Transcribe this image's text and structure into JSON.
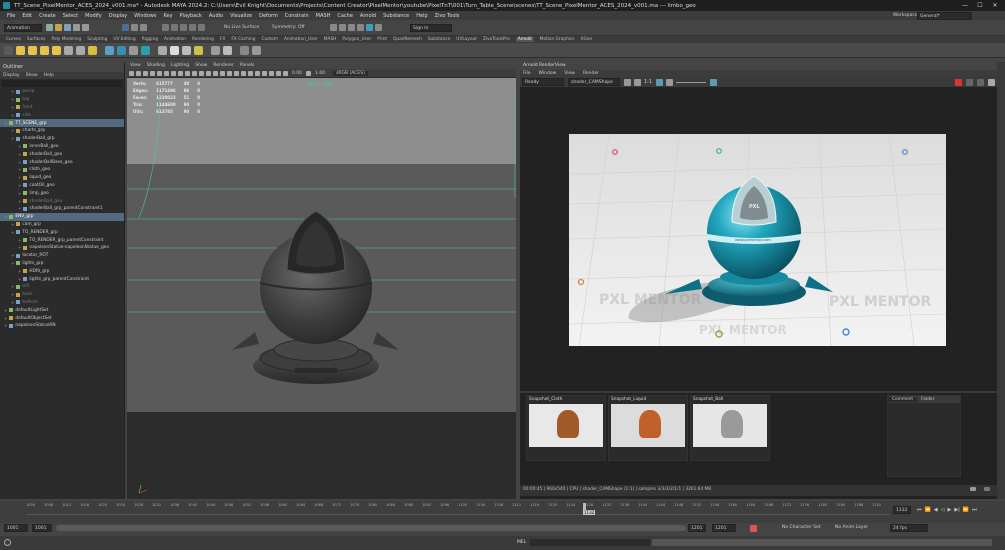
{
  "window": {
    "title": "TT_Scene_PixelMentor_ACES_2024_v001.ma* - Autodesk MAYA 2024.2: C:\\Users\\Evil Knight\\Documents\\Projects\\Content Creator\\PixelMentor\\youtube\\PixelTnT\\001\\Turn_Table_Scene\\scenes\\TT_Scene_PixelMentor_ACES_2024_v001.ma  ---  limbo_geo",
    "minimize": "—",
    "maximize": "☐",
    "close": "✕"
  },
  "menubar": [
    "File",
    "Edit",
    "Create",
    "Select",
    "Modify",
    "Display",
    "Windows",
    "Key",
    "Playback",
    "Audio",
    "Visualize",
    "Deform",
    "Constrain",
    "MASH",
    "Cache",
    "Arnold",
    "Substance",
    "Help",
    "Zivo Tools"
  ],
  "workspace": {
    "label": "Workspace:",
    "value": "General*"
  },
  "statusline": {
    "mode": "Animation",
    "live_surface": "No Live Surface",
    "symmetry": "Symmetry: Off",
    "sign_in": "Sign In"
  },
  "shelf_tabs": [
    "Curves",
    "Surfaces",
    "Poly Modeling",
    "Sculpting",
    "UV Editing",
    "Rigging",
    "Animation",
    "Rendering",
    "FX",
    "FX Caching",
    "Custom",
    "Animation_User",
    "MASH",
    "Polygon_User",
    "Print",
    "QuadRemesh",
    "Substance",
    "UVLayout",
    "ZivoToolsPro",
    "Arnold",
    "Motion Graphics",
    "XGen"
  ],
  "active_shelf": "Arnold",
  "outliner": {
    "title": "Outliner",
    "menu": [
      "Display",
      "Show",
      "Help"
    ],
    "items": [
      {
        "label": "persp",
        "state": "dim",
        "indent": 1
      },
      {
        "label": "top",
        "state": "dim",
        "indent": 1
      },
      {
        "label": "front",
        "state": "dim",
        "indent": 1
      },
      {
        "label": "side",
        "state": "dim",
        "indent": 1
      },
      {
        "label": "TT_SCENE_grp",
        "state": "sel",
        "indent": 0
      },
      {
        "label": "charts_grp",
        "state": "",
        "indent": 1
      },
      {
        "label": "shaderBall_grp",
        "state": "",
        "indent": 1
      },
      {
        "label": "innerBall_geo",
        "state": "",
        "indent": 2
      },
      {
        "label": "shaderBall_geo",
        "state": "",
        "indent": 2
      },
      {
        "label": "shaderBallBase_geo",
        "state": "",
        "indent": 2
      },
      {
        "label": "cloth_geo",
        "state": "",
        "indent": 2
      },
      {
        "label": "liquid_geo",
        "state": "",
        "indent": 2
      },
      {
        "label": "coatOil_geo",
        "state": "",
        "indent": 2
      },
      {
        "label": "limp_geo",
        "state": "",
        "indent": 2
      },
      {
        "label": "shaderBall_geo",
        "state": "dim",
        "indent": 2
      },
      {
        "label": "shaderBall_grp_parentConstraint1",
        "state": "",
        "indent": 2
      },
      {
        "label": "ENV_grp",
        "state": "sel",
        "indent": 0
      },
      {
        "label": "cam_grp",
        "state": "",
        "indent": 1
      },
      {
        "label": "TO_RENDER_grp",
        "state": "",
        "indent": 1
      },
      {
        "label": "TO_RENDER_grp_parentConstraint",
        "state": "",
        "indent": 2
      },
      {
        "label": "napoleonStatue:napoleonStatue_geo",
        "state": "",
        "indent": 2
      },
      {
        "label": "locator_ROT",
        "state": "",
        "indent": 1
      },
      {
        "label": "lights_grp",
        "state": "",
        "indent": 1
      },
      {
        "label": "HDRI_grp",
        "state": "",
        "indent": 2
      },
      {
        "label": "lights_grp_parentConstraint",
        "state": "",
        "indent": 2
      },
      {
        "label": "left",
        "state": "dim",
        "indent": 1
      },
      {
        "label": "back",
        "state": "dim",
        "indent": 1
      },
      {
        "label": "bottom",
        "state": "dim",
        "indent": 1
      },
      {
        "label": "defaultLightSet",
        "state": "",
        "indent": 0
      },
      {
        "label": "defaultObjectSet",
        "state": "",
        "indent": 0
      },
      {
        "label": "napoleonStatueRN",
        "state": "",
        "indent": 0
      }
    ]
  },
  "viewport": {
    "menu": [
      "View",
      "Shading",
      "Lighting",
      "Show",
      "Renderer",
      "Panels"
    ],
    "exposure": "0.00",
    "gamma": "1.00",
    "colorspace": "sRGB (ACES)",
    "resolution_gate": "1920 x 1080",
    "hud": [
      [
        "Verts:",
        "615777",
        "48",
        "0"
      ],
      [
        "Edges:",
        "1171496",
        "96",
        "0"
      ],
      [
        "Faces:",
        "1230023",
        "51",
        "0"
      ],
      [
        "Tris:",
        "1144600",
        "90",
        "0"
      ],
      [
        "UVs:",
        "613785",
        "90",
        "0"
      ]
    ]
  },
  "arnold": {
    "title": "Arnold RenderView",
    "menu": [
      "File",
      "Window",
      "View",
      "Render"
    ],
    "status": "Ready",
    "camera": "shader_CAMShape",
    "ratio": "1:1",
    "info": "00:00:45 | 960x540 | CPU | shader_CAMShape (1:1) | samples 3/3/3/2/1/1 | 3261.64 MB",
    "watermark": "PXL MENTOR",
    "ball_text": "www.pxlmentor.com"
  },
  "snapshots": [
    {
      "label": "Snapshot_Cloth"
    },
    {
      "label": "Snapshot_Liquid"
    },
    {
      "label": "Snapshot_Ball"
    }
  ],
  "side_tabs": [
    "Comment",
    "Folder"
  ],
  "timeline": {
    "ticks": [
      "1004",
      "1008",
      "1012",
      "1016",
      "1020",
      "1024",
      "1028",
      "1032",
      "1036",
      "1040",
      "1044",
      "1048",
      "1052",
      "1056",
      "1060",
      "1064",
      "1068",
      "1072",
      "1076",
      "1080",
      "1084",
      "1088",
      "1092",
      "1096",
      "1100",
      "1104",
      "1108",
      "1112",
      "1116",
      "1120",
      "1124",
      "1128",
      "1132",
      "1136",
      "1140",
      "1144",
      "1148",
      "1152",
      "1156",
      "1160",
      "1164",
      "1168",
      "1172",
      "1176",
      "1180",
      "1184",
      "1188",
      "1192"
    ],
    "current_frame": "1132",
    "current_value": "1132"
  },
  "range": {
    "start": "1001",
    "start2": "1001",
    "end": "1201",
    "end2": "1201",
    "char_set": "No Character Set",
    "anim_layer": "No Anim Layer",
    "fps": "24 fps"
  },
  "cmd": {
    "lang": "MEL"
  },
  "colors": {
    "teal": "#1f9ab0",
    "accent_blue": "#5285a6",
    "selection": "#546a7f"
  }
}
